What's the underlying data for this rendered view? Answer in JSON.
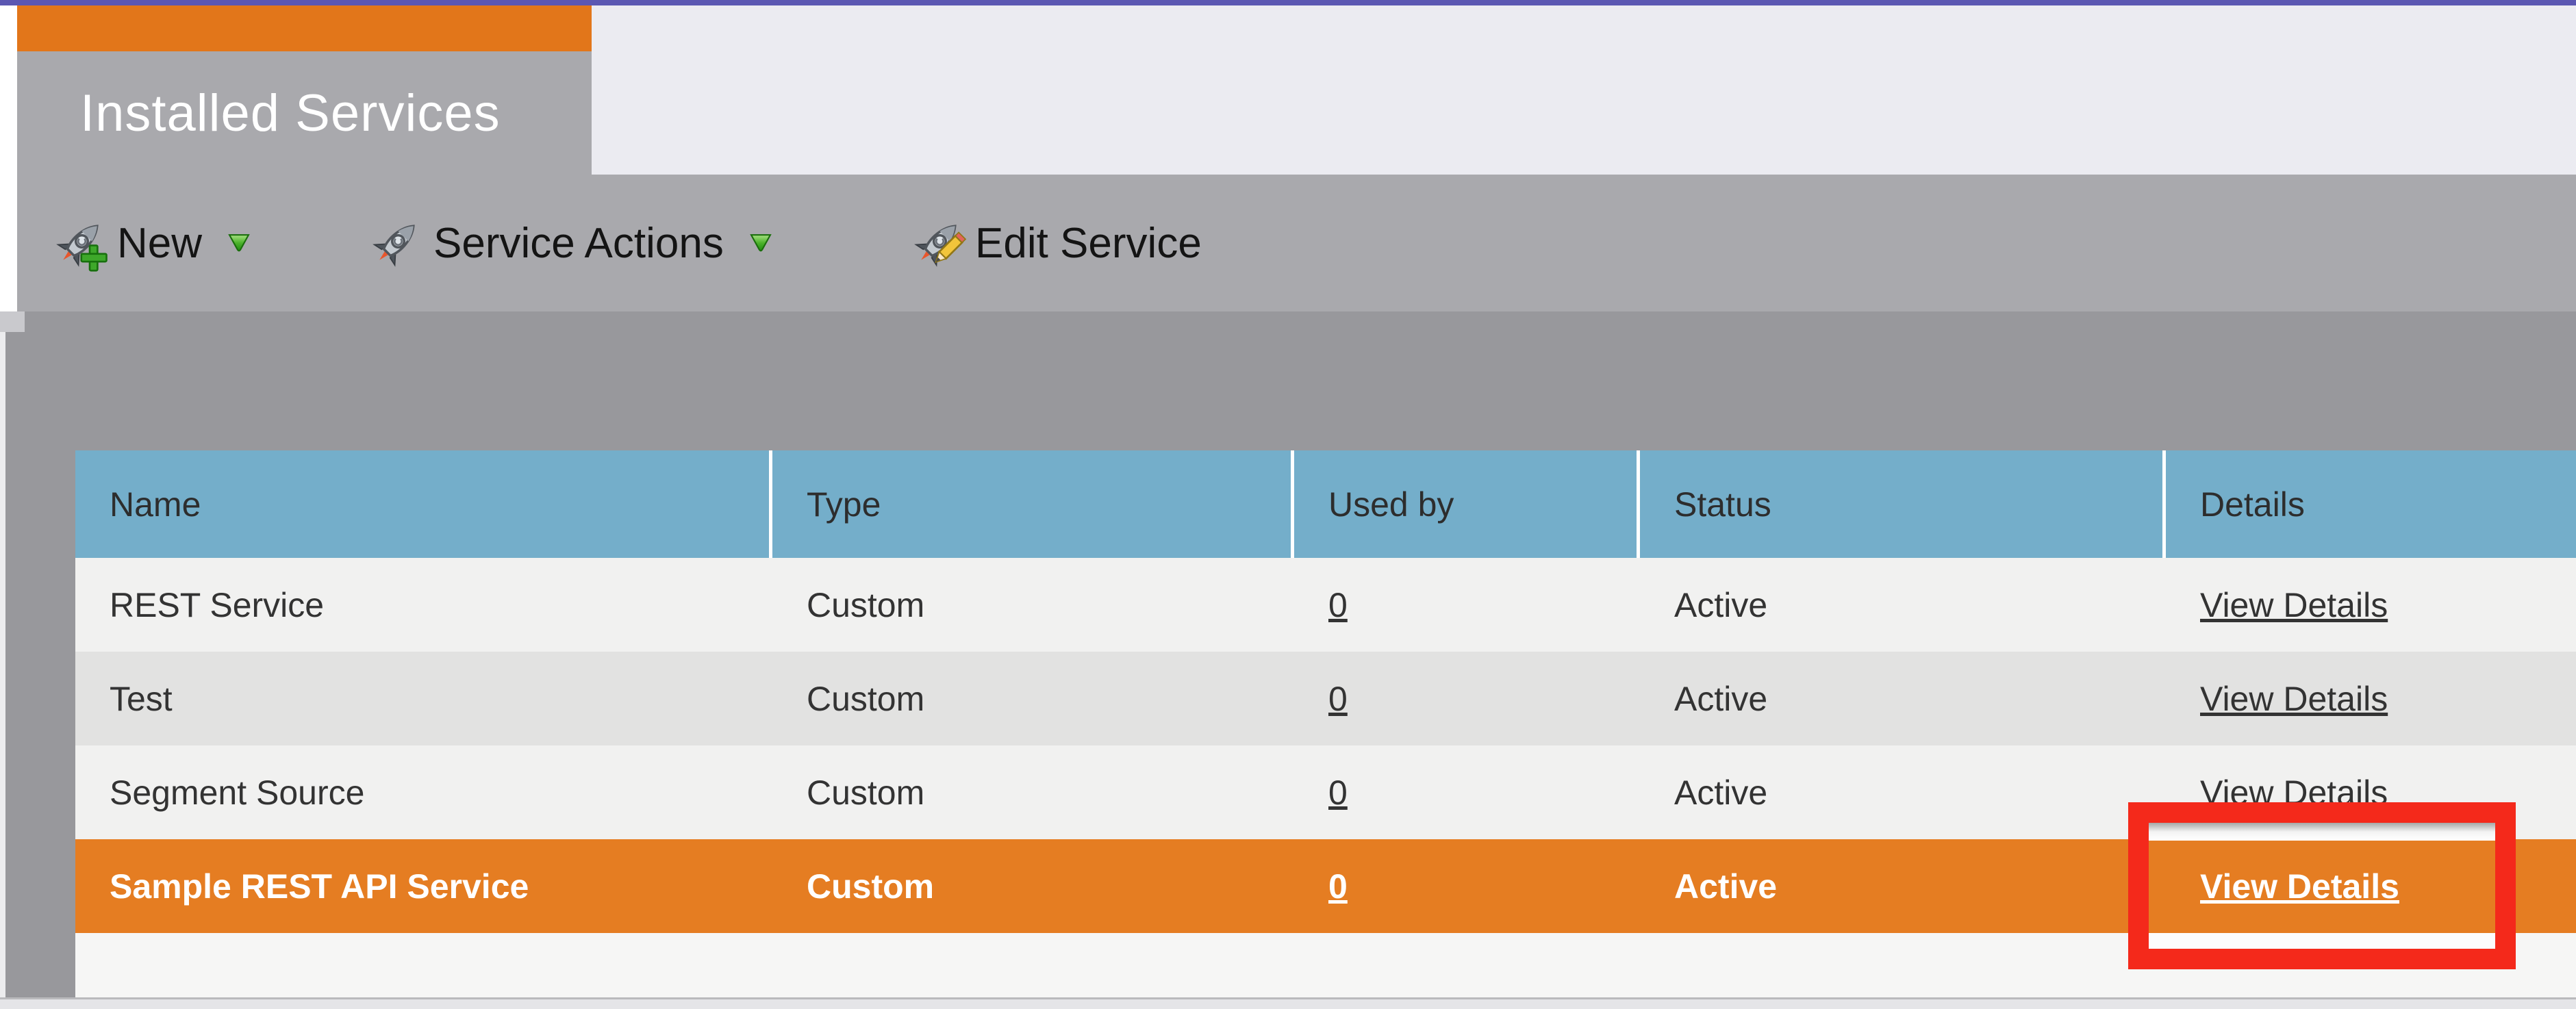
{
  "window": {
    "accent_color": "#5b57b2"
  },
  "tab": {
    "title": "Installed Services",
    "accent_color": "#e2761a"
  },
  "toolbar": {
    "new_label": "New",
    "service_actions_label": "Service Actions",
    "edit_service_label": "Edit Service"
  },
  "table": {
    "columns": [
      "Name",
      "Type",
      "Used by",
      "Status",
      "Details"
    ],
    "header_color": "#74aeca",
    "highlight_color": "#e57d22",
    "rows": [
      {
        "name": "REST Service",
        "type": "Custom",
        "used_by": "0",
        "status": "Active",
        "details": "View Details",
        "highlighted": false
      },
      {
        "name": "Test",
        "type": "Custom",
        "used_by": "0",
        "status": "Active",
        "details": "View Details",
        "highlighted": false
      },
      {
        "name": "Segment Source",
        "type": "Custom",
        "used_by": "0",
        "status": "Active",
        "details": "View Details",
        "highlighted": false
      },
      {
        "name": "Sample REST API Service",
        "type": "Custom",
        "used_by": "0",
        "status": "Active",
        "details": "View Details",
        "highlighted": true
      }
    ]
  },
  "annotation": {
    "shape": "rectangle",
    "color": "#f4291b",
    "target": "view-details-link-of-highlighted-row"
  }
}
